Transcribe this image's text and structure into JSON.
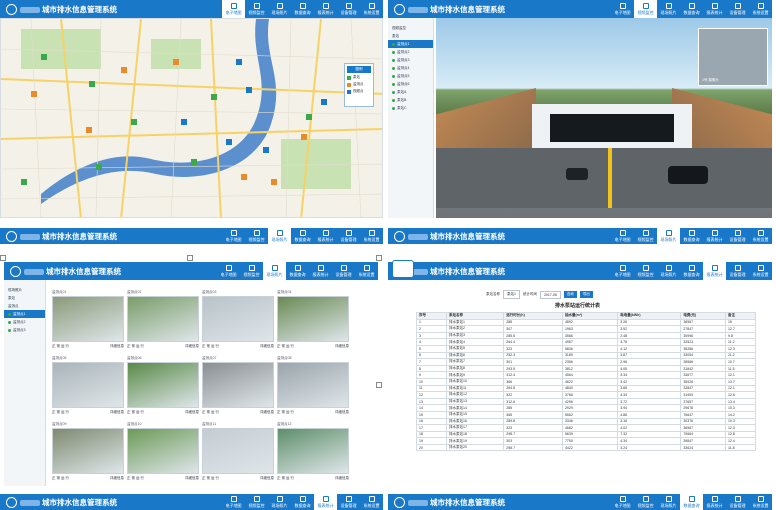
{
  "app": {
    "title": "城市排水信息管理系统",
    "nav": [
      "电子地图",
      "视频监控",
      "现场照片",
      "数据查询",
      "报表统计",
      "设备管理",
      "系统设置"
    ]
  },
  "map_panel": {
    "legend_title": "图例",
    "legend_items": [
      "泵站",
      "监测点",
      "视频点"
    ],
    "colors": {
      "water": "#5b8fce",
      "road": "#f6d266",
      "green": "#c9e2b3"
    }
  },
  "video_panel": {
    "sidebar": [
      "视频监控",
      "泵站",
      "监测点1",
      "监测点2",
      "监测点3",
      "监测点4",
      "监测点5",
      "监测点6",
      "泵站A",
      "泵站B",
      "泵站C"
    ],
    "pip_label": "1号 摄像头"
  },
  "photo_panel": {
    "sidebar": [
      "现场照片",
      "泵站",
      "监测点",
      "监测点1",
      "监测点2",
      "监测点3"
    ],
    "photos": [
      {
        "label": "监测点01",
        "cap_left": "正 常 运 行",
        "cap_right": "详细信息"
      },
      {
        "label": "监测点02",
        "cap_left": "正 常 运 行",
        "cap_right": "详细信息"
      },
      {
        "label": "监测点03",
        "cap_left": "正 常 运 行",
        "cap_right": "详细信息"
      },
      {
        "label": "监测点04",
        "cap_left": "正 常 运 行",
        "cap_right": "详细信息"
      },
      {
        "label": "监测点05",
        "cap_left": "正 常 运 行",
        "cap_right": "详细信息"
      },
      {
        "label": "监测点06",
        "cap_left": "正 常 运 行",
        "cap_right": "详细信息"
      },
      {
        "label": "监测点07",
        "cap_left": "正 常 运 行",
        "cap_right": "详细信息"
      },
      {
        "label": "监测点08",
        "cap_left": "正 常 运 行",
        "cap_right": "详细信息"
      },
      {
        "label": "监测点09",
        "cap_left": "正 常 运 行",
        "cap_right": "详细信息"
      },
      {
        "label": "监测点10",
        "cap_left": "正 常 运 行",
        "cap_right": "详细信息"
      },
      {
        "label": "监测点11",
        "cap_left": "正 常 运 行",
        "cap_right": "详细信息"
      },
      {
        "label": "监测点12",
        "cap_left": "正 常 运 行",
        "cap_right": "详细信息"
      }
    ]
  },
  "report_panel": {
    "filter_label1": "泵站名称",
    "filter_value1": "泵站1",
    "filter_label2": "统计时间",
    "filter_value2": "2017-06",
    "btn_query": "查询",
    "btn_export": "导出",
    "table_title": "排水泵站运行统计表",
    "columns": [
      "序号",
      "泵站名称",
      "运行时长(h)",
      "抽水量(m³)",
      "耗电量(kWh)",
      "电费(元)",
      "备注"
    ],
    "rows": [
      [
        "1",
        "排水泵站1",
        "288",
        "4892",
        "3.26",
        "36567",
        "15"
      ],
      [
        "2",
        "排水泵站2",
        "307",
        "1963",
        "3.52",
        "27847",
        "12.7"
      ],
      [
        "3",
        "排水泵站3",
        "285.5",
        "3566",
        "2.48",
        "30996",
        "9.8"
      ],
      [
        "4",
        "排水泵站4",
        "264.4",
        "4957",
        "3.78",
        "32523",
        "11.2"
      ],
      [
        "5",
        "排水泵站5",
        "323",
        "5836",
        "4.12",
        "35286",
        "12.3"
      ],
      [
        "6",
        "排水泵站6",
        "252.3",
        "3189",
        "3.87",
        "33094",
        "11.2"
      ],
      [
        "7",
        "排水泵站7",
        "301",
        "2356",
        "2.96",
        "28566",
        "10.7"
      ],
      [
        "8",
        "排水泵站8",
        "293.5",
        "3812",
        "4.05",
        "31842",
        "11.5"
      ],
      [
        "9",
        "排水泵站9",
        "312.4",
        "4564",
        "3.34",
        "33677",
        "12.1"
      ],
      [
        "10",
        "排水泵站10",
        "366",
        "4622",
        "3.42",
        "35926",
        "13.7"
      ],
      [
        "11",
        "排水泵站11",
        "264.8",
        "4840",
        "3.68",
        "32847",
        "12.1"
      ],
      [
        "12",
        "排水泵站12",
        "322",
        "3766",
        "4.34",
        "31953",
        "12.6"
      ],
      [
        "13",
        "排水泵站13",
        "312.6",
        "4296",
        "3.72",
        "37657",
        "13.4"
      ],
      [
        "14",
        "排水泵站14",
        "285",
        "2929",
        "3.94",
        "29678",
        "10.3"
      ],
      [
        "15",
        "排水泵站15",
        "365",
        "5562",
        "4.88",
        "76647",
        "14.2"
      ],
      [
        "16",
        "排水泵站16",
        "289.8",
        "3346",
        "3.16",
        "30376",
        "10.3"
      ],
      [
        "17",
        "排水泵站17",
        "323",
        "4682",
        "4.02",
        "36967",
        "12.3"
      ],
      [
        "18",
        "排水泵站18",
        "298.7",
        "5639",
        "7.32",
        "79664",
        "12.8"
      ],
      [
        "19",
        "排水泵站19",
        "303",
        "7750",
        "4.34",
        "39847",
        "12.4"
      ],
      [
        "20",
        "排水泵站20",
        "298.7",
        "4422",
        "3.24",
        "33624",
        "11.8"
      ]
    ]
  }
}
